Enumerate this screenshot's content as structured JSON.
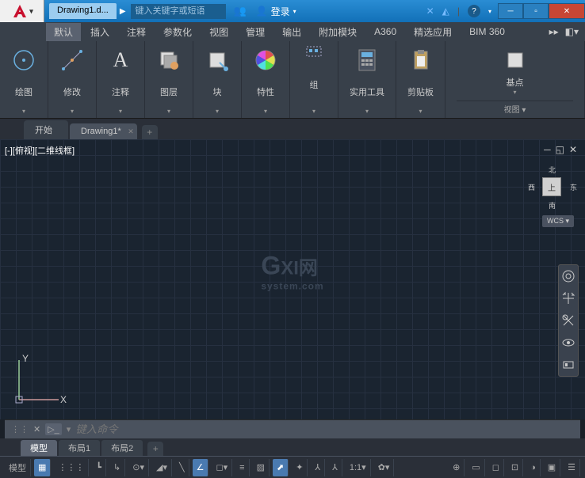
{
  "titlebar": {
    "doc_name": "Drawing1.d...",
    "search_placeholder": "键入关键字或短语",
    "login_label": "登录"
  },
  "menubar": {
    "items": [
      "默认",
      "插入",
      "注释",
      "参数化",
      "视图",
      "管理",
      "输出",
      "附加模块",
      "A360",
      "精选应用",
      "BIM 360"
    ],
    "active_index": 0
  },
  "ribbon": {
    "panels": [
      {
        "label": "绘图",
        "icon": "circle"
      },
      {
        "label": "修改",
        "icon": "move"
      },
      {
        "label": "注释",
        "icon": "text"
      },
      {
        "label": "图层",
        "icon": "layers"
      },
      {
        "label": "块",
        "icon": "block"
      },
      {
        "label": "特性",
        "icon": "color-wheel"
      },
      {
        "label": "组",
        "icon": "group"
      },
      {
        "label": "实用工具",
        "icon": "calculator"
      },
      {
        "label": "剪贴板",
        "icon": "clipboard"
      },
      {
        "label": "基点",
        "icon": "base"
      }
    ],
    "footer": "视图 ▾"
  },
  "file_tabs": {
    "start": "开始",
    "tabs": [
      "Drawing1*"
    ],
    "active_index": 0
  },
  "canvas": {
    "view_label": "[-][俯视][二维线框]",
    "viewcube": {
      "top": "上",
      "north": "北",
      "south": "南",
      "east": "东",
      "west": "西"
    },
    "wcs": "WCS",
    "axis_y": "Y",
    "axis_x": "X"
  },
  "watermark": {
    "main": "GXI网",
    "sub": "system.com"
  },
  "cmd": {
    "placeholder": "键入命令"
  },
  "layout_tabs": {
    "tabs": [
      "模型",
      "布局1",
      "布局2"
    ],
    "active_index": 0
  },
  "statusbar": {
    "model": "模型",
    "scale": "1:1"
  }
}
